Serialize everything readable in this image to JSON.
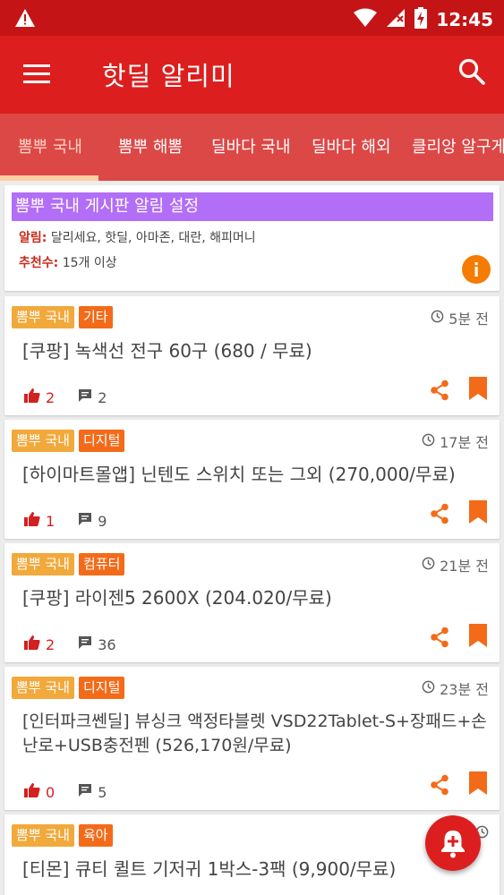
{
  "status_bar": {
    "time": "12:45"
  },
  "app_bar": {
    "title": "핫딜 알리미"
  },
  "tabs": [
    {
      "label": "뽐뿌 국내",
      "active": true
    },
    {
      "label": "뽐뿌 해뽐",
      "active": false
    },
    {
      "label": "딜바다 국내",
      "active": false
    },
    {
      "label": "딜바다 해외",
      "active": false
    },
    {
      "label": "클리앙 알구게",
      "active": false
    }
  ],
  "settings_card": {
    "header": "뽐뿌 국내 게시판 알림 설정",
    "alert_label": "알림:",
    "alert_value": "달리세요, 핫딜, 아마존, 대란, 해피머니",
    "recommend_label": "추천수:",
    "recommend_value": "15개 이상"
  },
  "posts": [
    {
      "board": "뽐뿌 국내",
      "category": "기타",
      "time": "5분 전",
      "title": "[쿠팡] 녹색선 전구 60구 (680 / 무료)",
      "likes": "2",
      "comments": "2"
    },
    {
      "board": "뽐뿌 국내",
      "category": "디지털",
      "time": "17분 전",
      "title": "[하이마트몰앱] 닌텐도 스위치 또는 그외 (270,000/무료)",
      "likes": "1",
      "comments": "9"
    },
    {
      "board": "뽐뿌 국내",
      "category": "컴퓨터",
      "time": "21분 전",
      "title": "[쿠팡] 라이젠5 2600X (204.020/무료)",
      "likes": "2",
      "comments": "36"
    },
    {
      "board": "뽐뿌 국내",
      "category": "디지털",
      "time": "23분 전",
      "title": "[인터파크쎈딜] 뷰싱크 액정타블렛 VSD22Tablet-S+장패드+손난로+USB충전펜 (526,170원/무료)",
      "likes": "0",
      "comments": "5"
    },
    {
      "board": "뽐뿌 국내",
      "category": "육아",
      "time": "",
      "title": "[티몬] 큐티 퀼트 기저귀 1박스-3팩 (9,900/무료)",
      "likes": "",
      "comments": ""
    }
  ],
  "colors": {
    "status_bar": "#c41416",
    "app_bar": "#dc1f1e",
    "tab_bar": "#dc4846",
    "tab_indicator": "#ffcf9e",
    "badge_board": "#f2a93b",
    "badge_category": "#f36b19",
    "settings_header": "#b26ef7",
    "accent": "#f57c00"
  }
}
